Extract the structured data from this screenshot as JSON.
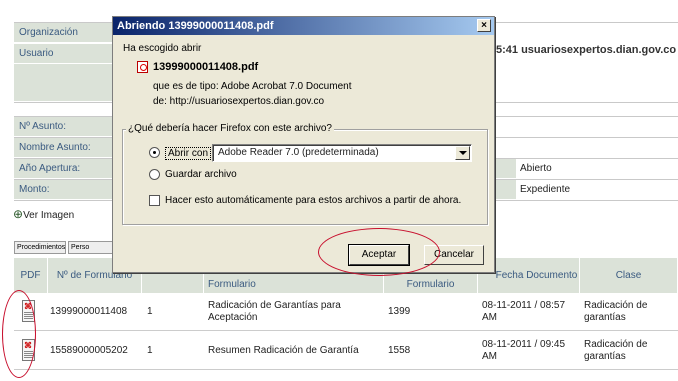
{
  "form": {
    "labels": [
      "Organización",
      "Usuario",
      "Nº Asunto:",
      "Nombre Asunto:",
      "Año Apertura:",
      "Monto:"
    ],
    "user_value": "5:41 usuariosexpertos.dian.gov.co",
    "estado_value": "Abierto",
    "tipo_value": "Expediente",
    "ver_imagen": "Ver Imagen"
  },
  "tabs": [
    "Procedimientos",
    "Perso"
  ],
  "table": {
    "headers": [
      "PDF",
      "Nº de Formulario",
      "",
      "Formulario",
      "Formulario",
      "Fecha Documento",
      "Clase"
    ],
    "rows": [
      {
        "numero": "13999000011408",
        "col": "1",
        "desc": "Radicación de Garantías para Aceptación",
        "form": "1399",
        "fecha": "08-11-2011 / 08:57 AM",
        "clase": "Radicación de garantías"
      },
      {
        "numero": "15589000005202",
        "col": "1",
        "desc": "Resumen Radicación de Garantía",
        "form": "1558",
        "fecha": "08-11-2011 / 09:45 AM",
        "clase": "Radicación de garantías"
      }
    ]
  },
  "dialog": {
    "title": "Abriendo 13999000011408.pdf",
    "intro": "Ha escogido abrir",
    "filename": "13999000011408.pdf",
    "type_line": "que es de tipo:  Adobe Acrobat 7.0 Document",
    "from_line": "de:  http://usuariosexpertos.dian.gov.co",
    "question": "¿Qué debería hacer Firefox con este archivo?",
    "open_with": "Abrir con",
    "app": "Adobe Reader 7.0 (predeterminada)",
    "save": "Guardar archivo",
    "auto": "Hacer esto automáticamente para estos archivos a partir de ahora.",
    "accept": "Aceptar",
    "cancel": "Cancelar"
  },
  "colors": {
    "annotation": "#c8102e",
    "titlebar": "#0a246a",
    "label_bg": "#dbe2d8"
  }
}
